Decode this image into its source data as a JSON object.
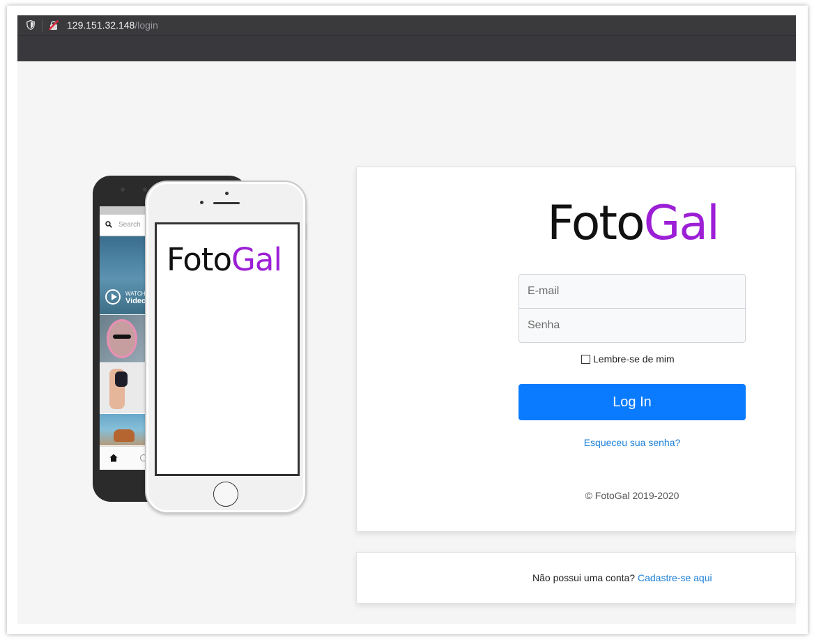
{
  "browser": {
    "url_host": "129.151.32.148",
    "url_path": "/login"
  },
  "brand": {
    "name_part1": "Foto",
    "name_part2": "Gal",
    "color_part1": "#111111",
    "color_part2": "#9c1fd6"
  },
  "phone_preview": {
    "search_placeholder": "Search",
    "watch_label": "WATCH",
    "video_label": "Video"
  },
  "login_form": {
    "email_placeholder": "E-mail",
    "password_placeholder": "Senha",
    "remember_label": "Lembre-se de mim",
    "remember_checked": false,
    "submit_label": "Log In",
    "forgot_link": "Esqueceu sua senha?",
    "copyright": "© FotoGal 2019-2020"
  },
  "signup": {
    "prompt": "Não possui uma conta?",
    "link": "Cadastre-se aqui"
  },
  "colors": {
    "primary_button": "#0a7bff",
    "link": "#1a7fd9",
    "page_background": "#f5f5f5"
  },
  "icons": [
    "shield-icon",
    "insecure-lock-icon",
    "search-icon",
    "play-icon",
    "home-icon"
  ]
}
